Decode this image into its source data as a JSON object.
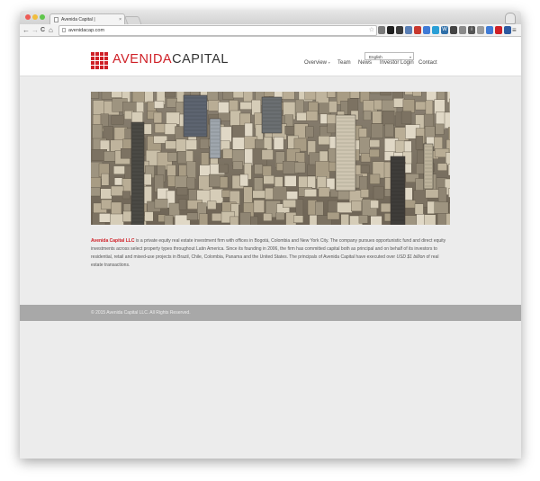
{
  "browser": {
    "tab_title": "Avenida Capital |",
    "tab_close": "×",
    "url": "avenidacap.com",
    "nav_back": "←",
    "nav_forward": "→",
    "nav_reload": "C",
    "nav_home": "⌂",
    "star": "☆",
    "menu": "≡",
    "traffic_lights": {
      "close": "#ee5b55",
      "minimize": "#f1bd3c",
      "zoom": "#5fc64b"
    },
    "extensions": [
      {
        "name": "ext-icon-1",
        "glyph": "",
        "color": "#7a7a7a"
      },
      {
        "name": "ext-icon-2",
        "glyph": "",
        "color": "#1f1f1f"
      },
      {
        "name": "ext-icon-3",
        "glyph": "",
        "color": "#3b3b3b"
      },
      {
        "name": "ext-icon-4",
        "glyph": "",
        "color": "#5a7fb5"
      },
      {
        "name": "ext-icon-5",
        "glyph": "",
        "color": "#c8382e"
      },
      {
        "name": "ext-icon-6",
        "glyph": "",
        "color": "#3f7bd6"
      },
      {
        "name": "ext-icon-7",
        "glyph": "",
        "color": "#2a9fd6"
      },
      {
        "name": "wordpress-icon",
        "glyph": "W",
        "color": "#2f6fa8"
      },
      {
        "name": "ext-icon-9",
        "glyph": "",
        "color": "#444"
      },
      {
        "name": "ext-icon-10",
        "glyph": "",
        "color": "#8a8a8a"
      },
      {
        "name": "ext-icon-11",
        "glyph": "i",
        "color": "#555"
      },
      {
        "name": "ext-icon-12",
        "glyph": "",
        "color": "#9b9b9b"
      },
      {
        "name": "ext-icon-13",
        "glyph": "",
        "color": "#3f7bd6"
      },
      {
        "name": "ext-icon-14",
        "glyph": "",
        "color": "#cf2027"
      },
      {
        "name": "ext-icon-15",
        "glyph": "",
        "color": "#2c5aa0"
      }
    ]
  },
  "site": {
    "logo": {
      "part1": "AVENIDA",
      "part2": "CAPITAL"
    },
    "language": "English",
    "nav": {
      "overview": "Overview",
      "overview_chevron": "▾",
      "team": "Team",
      "news": "News",
      "investor_login": "Investor Login",
      "contact": "Contact"
    },
    "about": {
      "brand": "Avenida Capital LLC",
      "p1": " is a private equity real estate investment firm with offices in Bogotá, Colombia and New York City.  The company pursues opportunistic fund and direct equity investments across select property types throughout Latin America.  Since its founding in 2006, the firm has committed capital both as principal and on behalf of its investors to residential, retail and mixed-use projects in Brazil, Chile, Colombia, Panama and the United States.  The principals of Avenida Capital have executed over ",
      "amount": "USD $1 billion",
      "p2": " of real estate transactions."
    },
    "footer": "© 2015 Avenida Capital LLC. All Rights Reserved.",
    "colors": {
      "brand_red": "#cf2027",
      "footer_bg": "#a8a8a8",
      "page_bg": "#ececec"
    }
  }
}
